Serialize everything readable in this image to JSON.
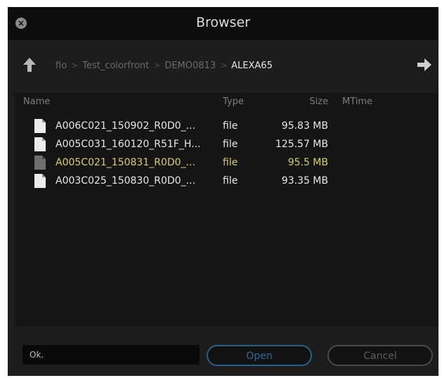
{
  "window": {
    "title": "Browser"
  },
  "path": {
    "crumbs": [
      "fio",
      "Test_colorfront",
      "DEMO0813",
      "ALEXA65"
    ],
    "separator": ">"
  },
  "list": {
    "headers": {
      "name": "Name",
      "type": "Type",
      "size": "Size",
      "mtime": "MTime"
    },
    "files": [
      {
        "name": "A006C021_150902_R0D0_...",
        "type": "file",
        "size": "95.83 MB",
        "mtime": ""
      },
      {
        "name": "A005C031_160120_R51F_H...",
        "type": "file",
        "size": "125.57 MB",
        "mtime": ""
      },
      {
        "name": "A005C021_150831_R0D0_...",
        "type": "file",
        "size": "95.5 MB",
        "mtime": "",
        "selected": true
      },
      {
        "name": "A003C025_150830_R0D0_...",
        "type": "file",
        "size": "93.35 MB",
        "mtime": ""
      }
    ]
  },
  "footer": {
    "status_value": "Ok.",
    "open_label": "Open",
    "cancel_label": "Cancel"
  },
  "icons": {
    "close": "close-icon",
    "up": "arrow-up-icon",
    "forward": "arrow-right-icon",
    "file": "file-icon"
  },
  "colors": {
    "selected_text": "#d8cf6a",
    "open_button": "#2c5f86"
  }
}
